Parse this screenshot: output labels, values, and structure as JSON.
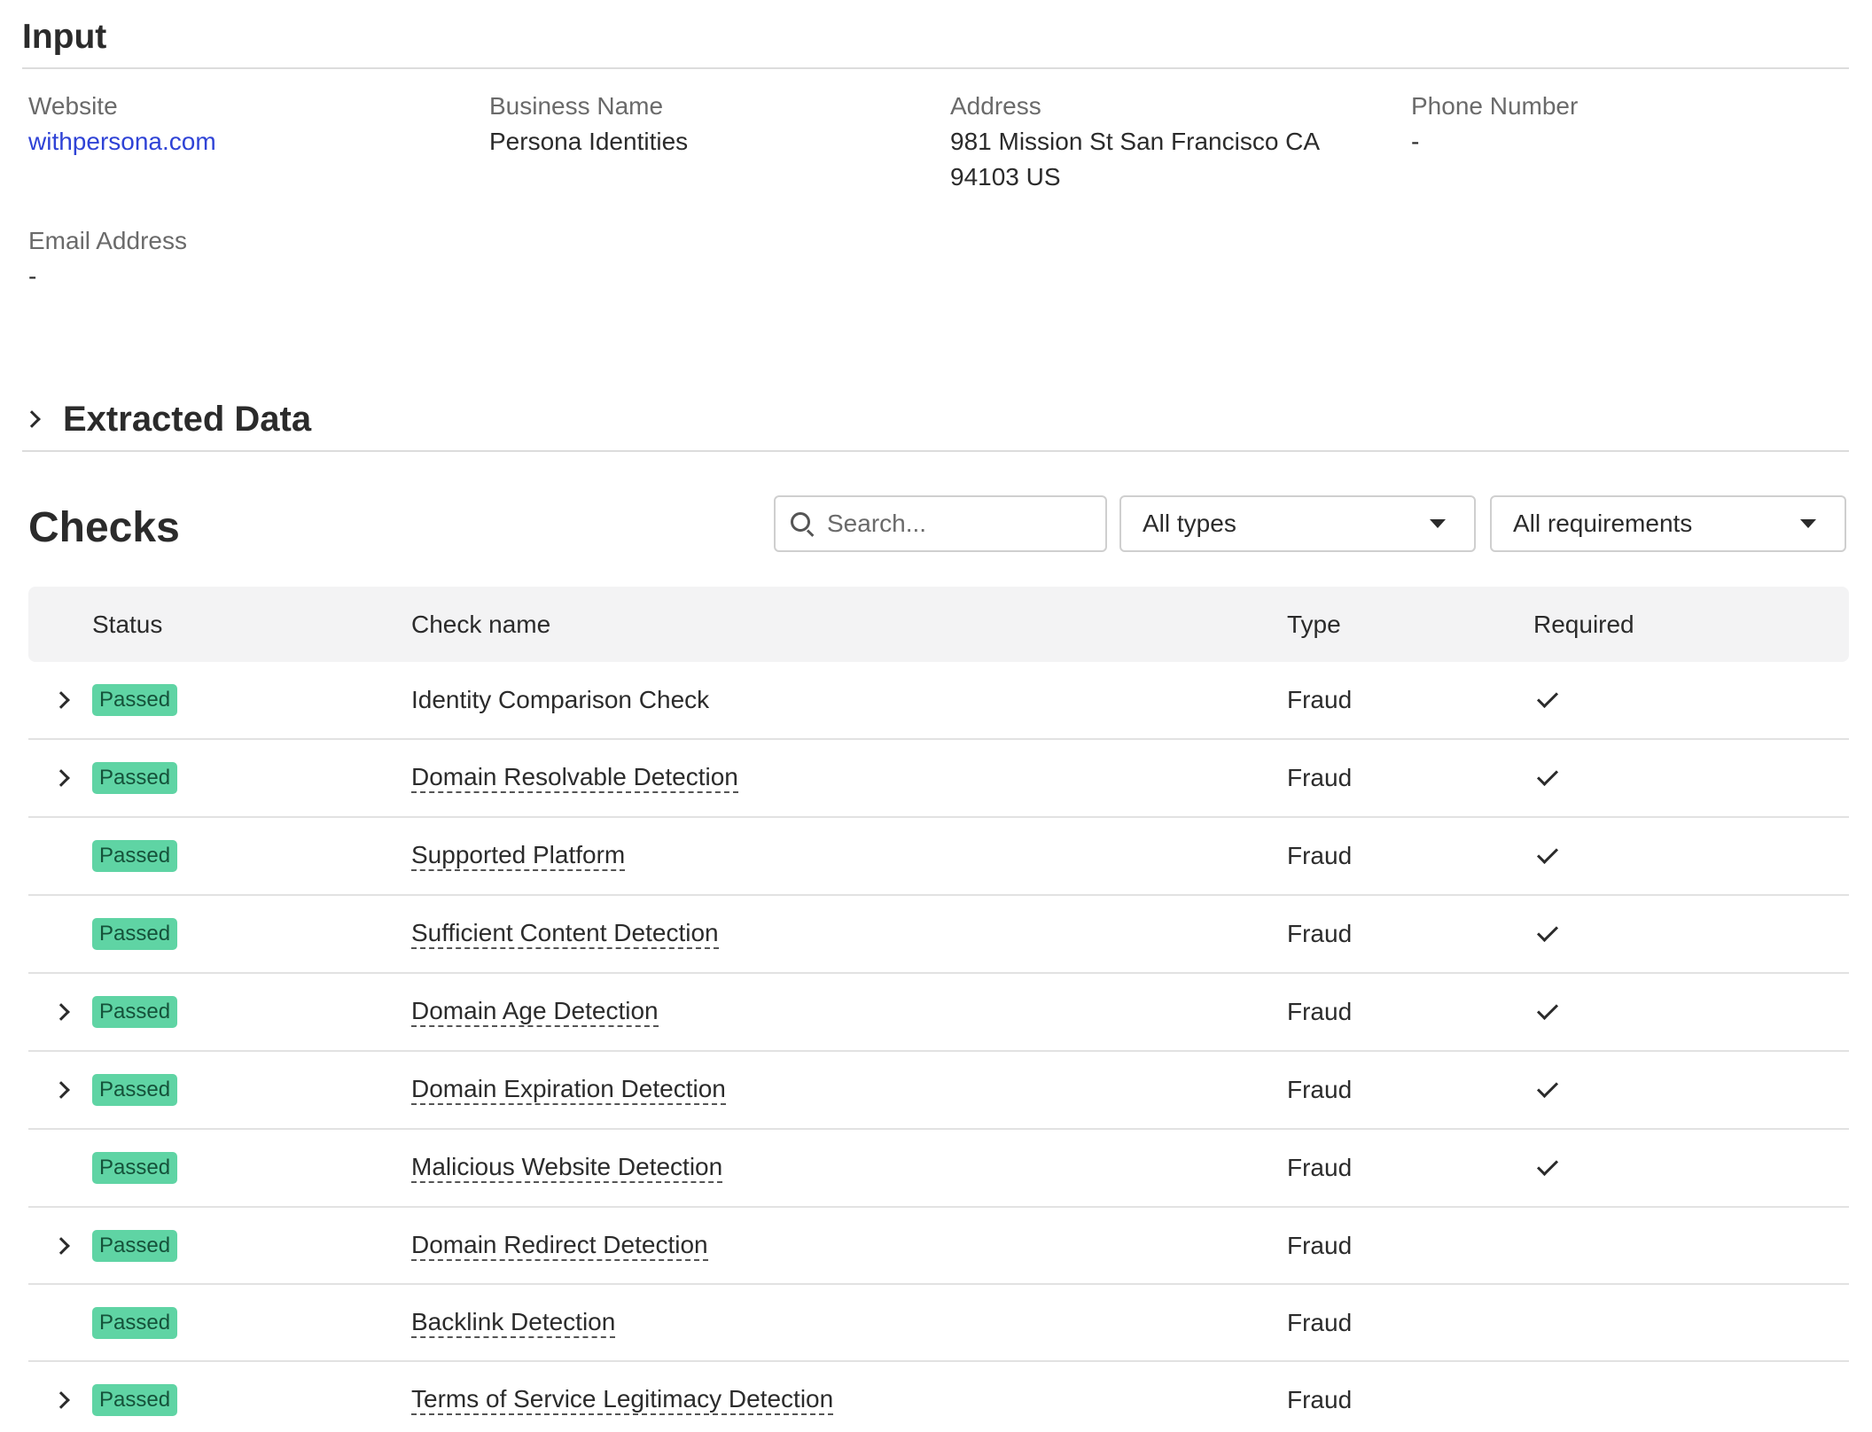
{
  "input": {
    "title": "Input",
    "fields": {
      "website": {
        "label": "Website",
        "value": "withpersona.com"
      },
      "business_name": {
        "label": "Business Name",
        "value": "Persona Identities"
      },
      "address": {
        "label": "Address",
        "value": "981 Mission St San Francisco CA 94103 US"
      },
      "phone": {
        "label": "Phone Number",
        "value": "-"
      },
      "email": {
        "label": "Email Address",
        "value": "-"
      }
    }
  },
  "extracted": {
    "title": "Extracted Data"
  },
  "checks": {
    "title": "Checks",
    "search_placeholder": "Search...",
    "type_filter": "All types",
    "requirement_filter": "All requirements",
    "columns": {
      "status": "Status",
      "name": "Check name",
      "type": "Type",
      "required": "Required"
    },
    "rows": [
      {
        "status": "Passed",
        "name": "Identity Comparison Check",
        "type": "Fraud",
        "required": true,
        "expandable": true
      },
      {
        "status": "Passed",
        "name": "Domain Resolvable Detection",
        "type": "Fraud",
        "required": true,
        "expandable": true
      },
      {
        "status": "Passed",
        "name": "Supported Platform",
        "type": "Fraud",
        "required": true,
        "expandable": false
      },
      {
        "status": "Passed",
        "name": "Sufficient Content Detection",
        "type": "Fraud",
        "required": true,
        "expandable": false
      },
      {
        "status": "Passed",
        "name": "Domain Age Detection",
        "type": "Fraud",
        "required": true,
        "expandable": true
      },
      {
        "status": "Passed",
        "name": "Domain Expiration Detection",
        "type": "Fraud",
        "required": true,
        "expandable": true
      },
      {
        "status": "Passed",
        "name": "Malicious Website Detection",
        "type": "Fraud",
        "required": true,
        "expandable": false
      },
      {
        "status": "Passed",
        "name": "Domain Redirect Detection",
        "type": "Fraud",
        "required": false,
        "expandable": true
      },
      {
        "status": "Passed",
        "name": "Backlink Detection",
        "type": "Fraud",
        "required": false,
        "expandable": false
      },
      {
        "status": "Passed",
        "name": "Terms of Service Legitimacy Detection",
        "type": "Fraud",
        "required": false,
        "expandable": true
      }
    ]
  }
}
